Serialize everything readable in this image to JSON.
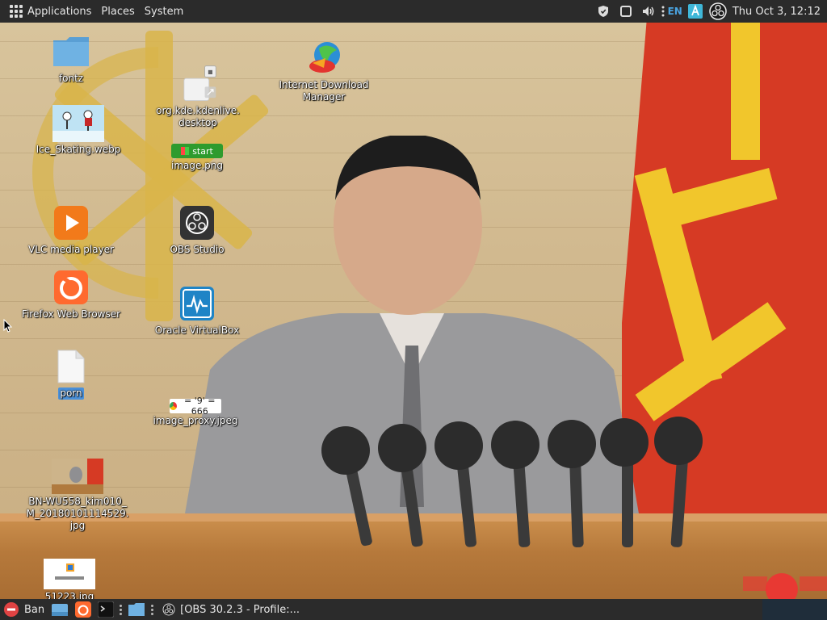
{
  "top_panel": {
    "menu": [
      "Applications",
      "Places",
      "System"
    ],
    "tray_icons": [
      "shield-icon",
      "window-icon",
      "volume-icon",
      "menu-dots-icon",
      "keyboard-icon",
      "obs-tray-icon"
    ],
    "language": "EN",
    "clock": "Thu Oct 3, 12:12"
  },
  "desktop_icons": [
    {
      "id": "fontz",
      "label": "fontz",
      "icon": "folder-icon"
    },
    {
      "id": "ice-skating",
      "label": "Ice_Skating.webp",
      "icon": "image-thumbnail-icon"
    },
    {
      "id": "vlc",
      "label": "VLC media player",
      "icon": "vlc-icon"
    },
    {
      "id": "firefox",
      "label": "Firefox Web Browser",
      "icon": "firefox-icon"
    },
    {
      "id": "porn",
      "label": "porn",
      "icon": "text-file-icon"
    },
    {
      "id": "bn-image",
      "label": "BN-WU558_kim010_\nM_20180101114529.\njpg",
      "icon": "image-thumbnail-icon"
    },
    {
      "id": "51223",
      "label": "51223.jpg",
      "icon": "image-thumbnail-icon"
    },
    {
      "id": "kdenlive",
      "label": "org.kde.kdenlive.\ndesktop",
      "icon": "desktop-file-icon"
    },
    {
      "id": "image-png",
      "label": "image.png",
      "icon": "image-thumbnail-icon",
      "thumb_text": "start"
    },
    {
      "id": "obs",
      "label": "OBS Studio",
      "icon": "obs-icon"
    },
    {
      "id": "virtualbox",
      "label": "Oracle VirtualBox",
      "icon": "virtualbox-icon"
    },
    {
      "id": "image-proxy",
      "label": "image_proxy.jpeg",
      "icon": "image-thumbnail-icon",
      "thumb_text": "= '9' = 666"
    },
    {
      "id": "idm",
      "label": "Internet Download\nManager",
      "icon": "idm-icon"
    }
  ],
  "taskbar": {
    "items": [
      {
        "label": "Ban",
        "icon": "stop-icon"
      },
      {
        "label": "",
        "icon": "files-icon"
      },
      {
        "label": "",
        "icon": "firefox-small-icon"
      },
      {
        "label": "",
        "icon": "terminal-icon"
      },
      {
        "label": "",
        "icon": "folder-small-icon"
      }
    ],
    "window_title": "[OBS 30.2.3 - Profile:..."
  },
  "colors": {
    "panel_bg": "#2b2b2b",
    "selection": "#4a90d9",
    "flag_red": "#d63a24",
    "flag_yellow": "#f1c62c"
  }
}
